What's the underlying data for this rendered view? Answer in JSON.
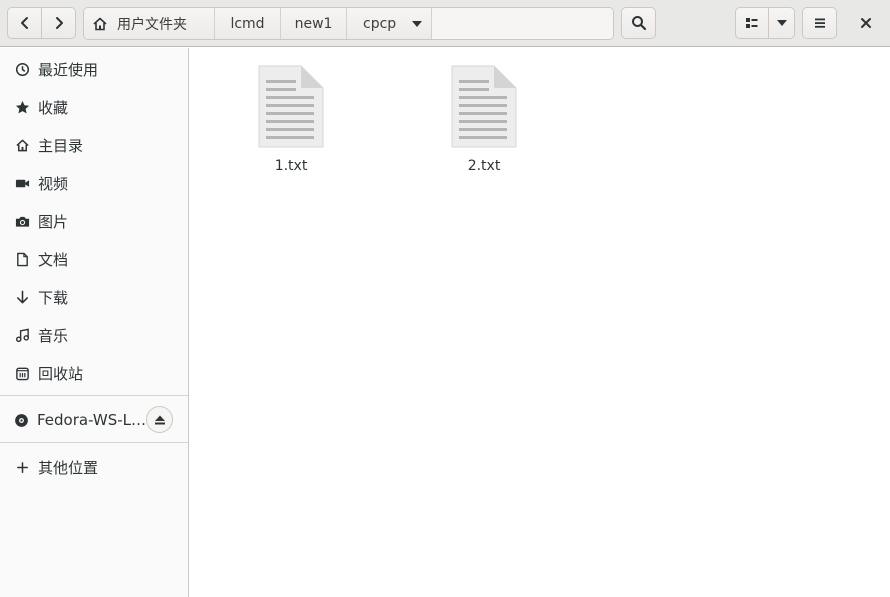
{
  "breadcrumbs": {
    "home": "用户文件夹",
    "items": [
      "lcmd",
      "new1",
      "cpcp"
    ]
  },
  "sidebar": {
    "places": [
      {
        "label": "最近使用",
        "icon": "recent-icon"
      },
      {
        "label": "收藏",
        "icon": "star-icon"
      },
      {
        "label": "主目录",
        "icon": "home-icon"
      },
      {
        "label": "视频",
        "icon": "video-icon"
      },
      {
        "label": "图片",
        "icon": "camera-icon"
      },
      {
        "label": "文档",
        "icon": "document-icon"
      },
      {
        "label": "下载",
        "icon": "download-icon"
      },
      {
        "label": "音乐",
        "icon": "music-icon"
      },
      {
        "label": "回收站",
        "icon": "trash-icon"
      }
    ],
    "device": {
      "label": "Fedora-WS-L…",
      "icon": "disc-icon"
    },
    "other": {
      "label": "其他位置",
      "icon": "plus-icon"
    }
  },
  "files": [
    {
      "name": "1.txt",
      "icon": "text-file-icon"
    },
    {
      "name": "2.txt",
      "icon": "text-file-icon"
    }
  ]
}
